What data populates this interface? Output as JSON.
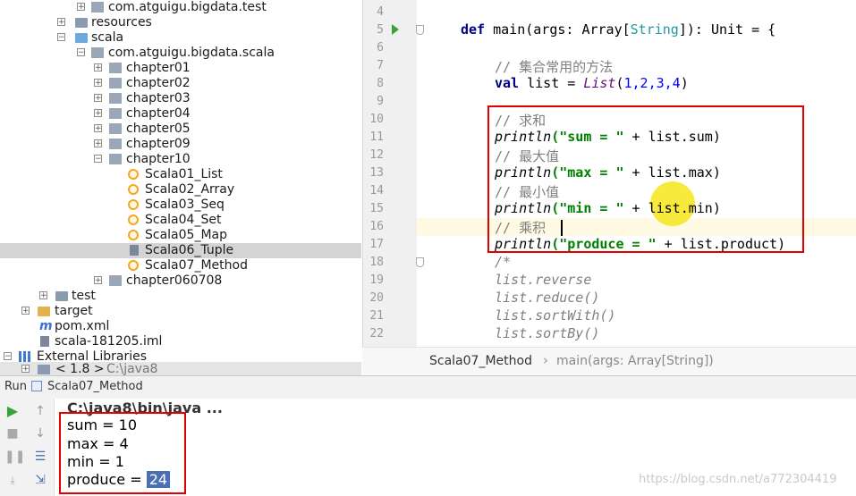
{
  "tree": {
    "items": [
      {
        "label": "com.atguigu.bigdata.test"
      },
      {
        "label": "resources"
      },
      {
        "label": "scala"
      },
      {
        "label": "com.atguigu.bigdata.scala"
      },
      {
        "label": "chapter01"
      },
      {
        "label": "chapter02"
      },
      {
        "label": "chapter03"
      },
      {
        "label": "chapter04"
      },
      {
        "label": "chapter05"
      },
      {
        "label": "chapter09"
      },
      {
        "label": "chapter10"
      },
      {
        "label": "Scala01_List"
      },
      {
        "label": "Scala02_Array"
      },
      {
        "label": "Scala03_Seq"
      },
      {
        "label": "Scala04_Set"
      },
      {
        "label": "Scala05_Map"
      },
      {
        "label": "Scala06_Tuple"
      },
      {
        "label": "Scala07_Method"
      },
      {
        "label": "chapter060708"
      },
      {
        "label": "test"
      },
      {
        "label": "target"
      },
      {
        "label": "pom.xml"
      },
      {
        "label": "scala-181205.iml"
      },
      {
        "label": "External Libraries"
      },
      {
        "label": "< 1.8 >",
        "extra": "C:\\java8"
      }
    ]
  },
  "editor": {
    "line_numbers": [
      "4",
      "5",
      "6",
      "7",
      "8",
      "9",
      "10",
      "11",
      "12",
      "13",
      "14",
      "15",
      "16",
      "17",
      "18",
      "19",
      "20",
      "21",
      "22"
    ],
    "code": {
      "l5_def": "def",
      "l5_rest1": " main(args: Array[",
      "l5_type": "String",
      "l5_rest2": "]): Unit = {",
      "l7_comment": "// 集合常用的方法",
      "l8_val": "val",
      "l8_mid": " list = ",
      "l8_list": "List",
      "l8_open": "(",
      "l8_nums": "1,2,3,4",
      "l8_close": ")",
      "l10_comment": "// 求和",
      "l11_fn": "println",
      "l11_str": "(\"sum = \"",
      "l11_rest": " + list.sum)",
      "l12_comment": "// 最大值",
      "l13_fn": "println",
      "l13_str": "(\"max = \"",
      "l13_rest": " + list.max)",
      "l14_comment": "// 最小值",
      "l15_fn": "println",
      "l15_str": "(\"min = \"",
      "l15_rest": " + list.min)",
      "l16_comment": "// 乘积",
      "l17_fn": "println",
      "l17_str": "(\"produce = \"",
      "l17_rest": " + list.product)",
      "l18": "/*",
      "l19": "list.reverse",
      "l20": "list.reduce()",
      "l21": "list.sortWith()",
      "l22": "list.sortBy()"
    },
    "breadcrumb": {
      "file": "Scala07_Method",
      "method": "main(args: Array[String])"
    }
  },
  "run": {
    "tab_label": "Run",
    "config_label": "Scala07_Method",
    "console": {
      "cmd": "C:\\java8\\bin\\java ...",
      "l1": "sum = 10",
      "l2": "max = 4",
      "l3": "min = 1",
      "l4_prefix": "produce = ",
      "l4_value": "24"
    }
  },
  "watermark": "https://blog.csdn.net/a772304419",
  "colors": {
    "highlight_box": "#e00000",
    "cursor_dot": "#f7e51b",
    "selection": "#4a6fb5"
  }
}
